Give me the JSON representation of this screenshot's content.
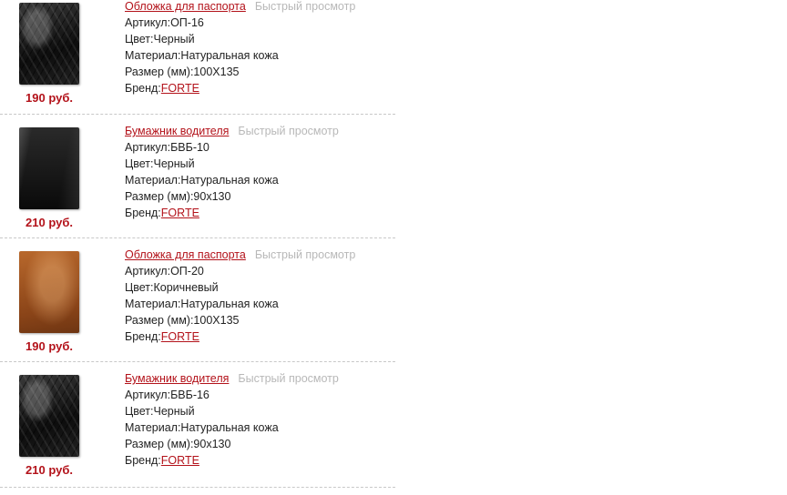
{
  "quick_view_label": "Быстрый просмотр",
  "labels": {
    "article": "Артикул:",
    "color": "Цвет:",
    "material": "Материал:",
    "size": "Размер (мм):",
    "brand": "Бренд:"
  },
  "products": [
    {
      "title": "Обложка для паспорта",
      "price": "190 руб.",
      "article": "ОП-16",
      "color": "Черный",
      "material": "Натуральная кожа",
      "size": "100Х135",
      "brand": "FORTE",
      "thumb_style": "croc-black"
    },
    {
      "title": "Бумажник водителя",
      "price": "210 руб.",
      "article": "БВБ-10",
      "color": "Черный",
      "material": "Натуральная кожа",
      "size": "90х130",
      "brand": "FORTE",
      "thumb_style": "smooth-black"
    },
    {
      "title": "Обложка для паспорта",
      "price": "190 руб.",
      "article": "ОП-20",
      "color": "Коричневый",
      "material": "Натуральная кожа",
      "size": "100Х135",
      "brand": "FORTE",
      "thumb_style": "brown"
    },
    {
      "title": "Бумажник водителя",
      "price": "210 руб.",
      "article": "БВБ-16",
      "color": "Черный",
      "material": "Натуральная кожа",
      "size": "90х130",
      "brand": "FORTE",
      "thumb_style": "croc-black"
    }
  ],
  "colors": {
    "accent": "#b3121a",
    "quick_view": "#b8b8b8",
    "text": "#222222",
    "divider": "#c8c8c8"
  }
}
